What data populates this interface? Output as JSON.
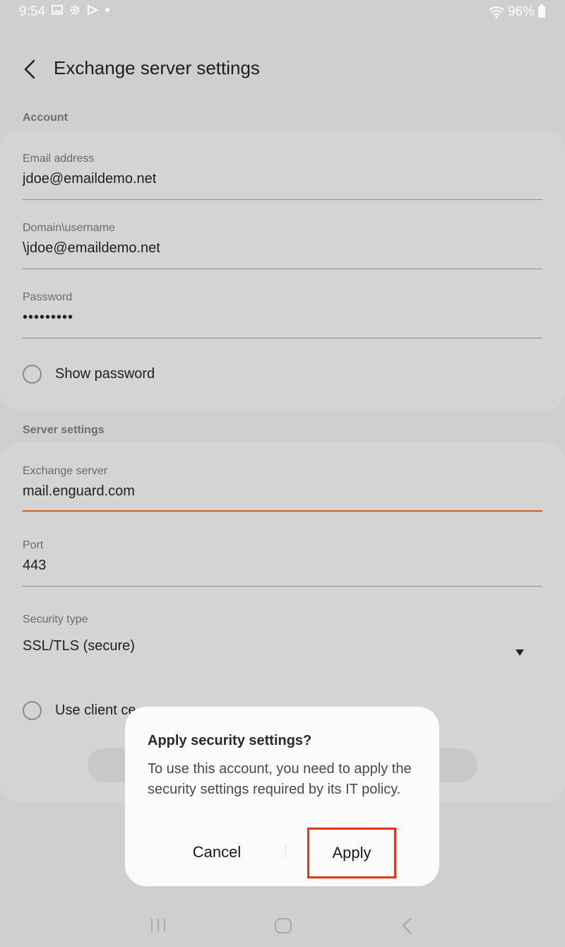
{
  "status_bar": {
    "time": "9:54",
    "icons": [
      "gallery-icon",
      "settings-icon",
      "play-store-icon",
      "notification-dot-icon"
    ],
    "battery": "96%"
  },
  "header": {
    "title": "Exchange server settings"
  },
  "account": {
    "section_label": "Account",
    "email": {
      "label": "Email address",
      "value": "jdoe@emaildemo.net"
    },
    "domain_username": {
      "label": "Domain\\username",
      "value": "\\jdoe@emaildemo.net"
    },
    "password": {
      "label": "Password",
      "value": "•••••••••"
    },
    "show_password": "Show password"
  },
  "server": {
    "section_label": "Server settings",
    "exchange_server": {
      "label": "Exchange server",
      "value": "mail.enguard.com"
    },
    "port": {
      "label": "Port",
      "value": "443"
    },
    "security_type": {
      "label": "Security type",
      "value": "SSL/TLS (secure)"
    },
    "client_cert": "Use client ce"
  },
  "dialog": {
    "title": "Apply security settings?",
    "body": "To use this account, you need to apply the security settings required by its IT policy.",
    "cancel": "Cancel",
    "apply": "Apply",
    "highlight_color": "#e5331a"
  },
  "colors": {
    "accent": "#d05a2e",
    "background": "#cfcfcf"
  }
}
